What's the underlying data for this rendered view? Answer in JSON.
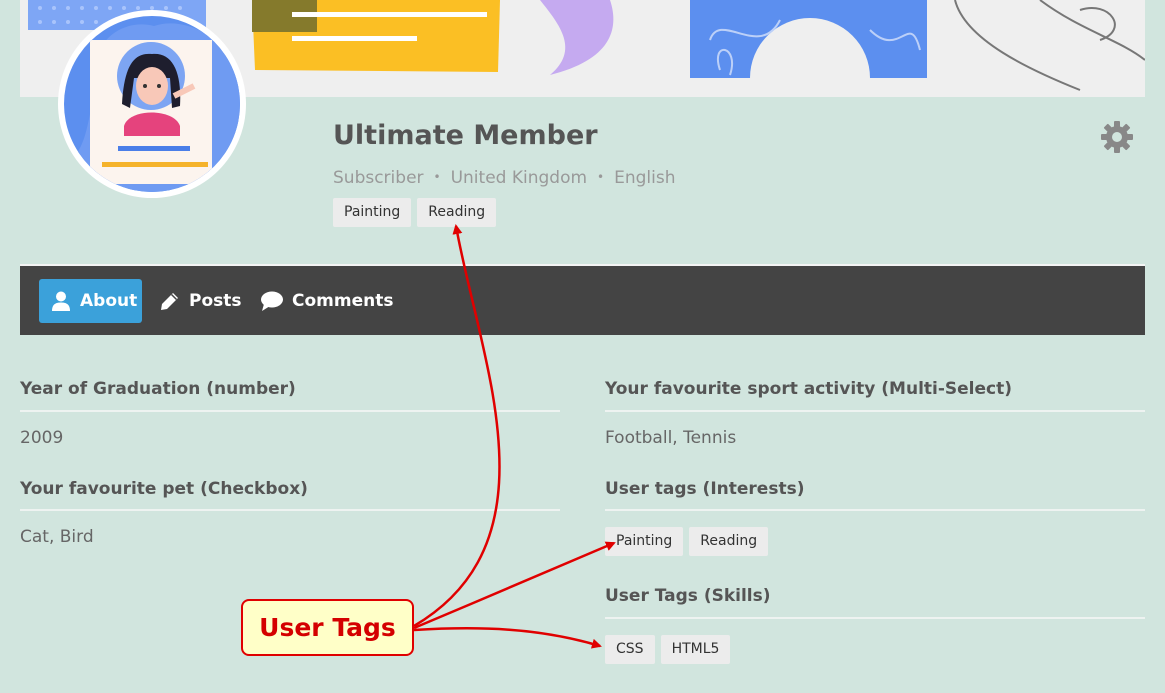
{
  "profile": {
    "name": "Ultimate Member",
    "role": "Subscriber",
    "country": "United Kingdom",
    "language": "English",
    "tags": [
      "Painting",
      "Reading"
    ]
  },
  "nav": {
    "about": "About",
    "posts": "Posts",
    "comments": "Comments"
  },
  "fields": {
    "graduation_label": "Year of Graduation (number)",
    "graduation_value": "2009",
    "pet_label": "Your favourite pet (Checkbox)",
    "pet_value": "Cat, Bird",
    "sport_label": "Your favourite sport activity (Multi-Select)",
    "sport_value": "Football, Tennis",
    "interests_label": "User tags (Interests)",
    "interests_tags": [
      "Painting",
      "Reading"
    ],
    "skills_label": "User Tags (Skills)",
    "skills_tags": [
      "CSS",
      "HTML5"
    ]
  },
  "annotation": {
    "callout_text": "User Tags"
  },
  "colors": {
    "background": "#d1e5de",
    "nav_background": "#444444",
    "nav_active": "#3ba1da",
    "callout_red": "#e00000",
    "callout_fill": "#ffffc8"
  }
}
